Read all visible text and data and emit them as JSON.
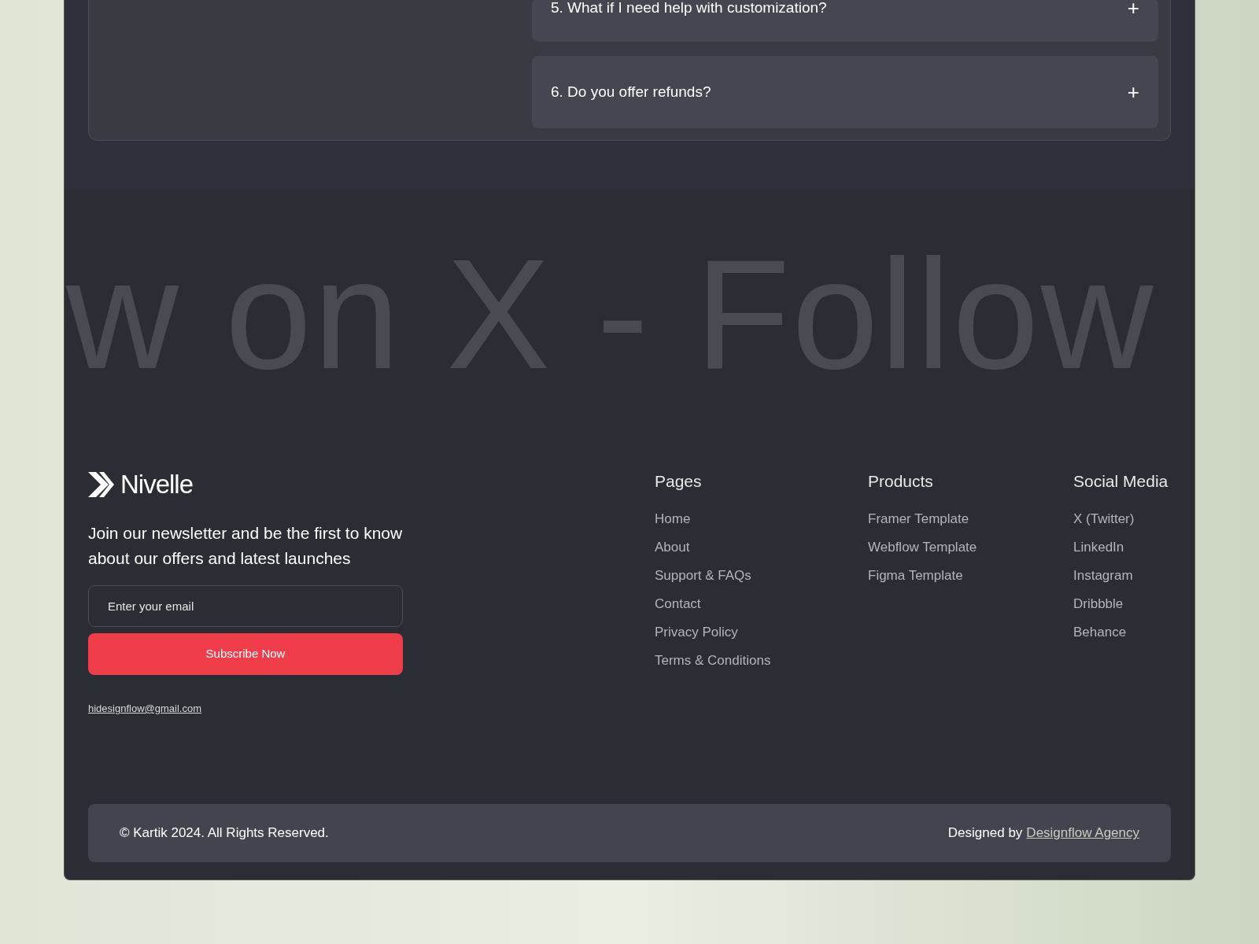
{
  "faq": {
    "items": [
      {
        "question": "5. What if I need help with customization?",
        "expanded": false,
        "toggle": "+"
      },
      {
        "question": "6. Do you offer refunds?",
        "expanded": false,
        "toggle": "+"
      }
    ]
  },
  "marquee": {
    "text": "w on X - Follow"
  },
  "footer": {
    "brand": "Nivelle",
    "newsletter_text": "Join our newsletter and be the first to know about our offers and latest launches",
    "email_field": {
      "placeholder": "Enter your email"
    },
    "subscribe_button": "Subscribe Now",
    "contact_email": "hidesignflow@gmail.com",
    "columns": [
      {
        "heading": "Pages",
        "links": [
          "Home",
          "About",
          "Support & FAQs",
          "Contact",
          "Privacy Policy",
          "Terms & Conditions"
        ]
      },
      {
        "heading": "Products",
        "links": [
          "Framer Template",
          "Webflow Template",
          "Figma Template"
        ]
      },
      {
        "heading": "Social Media",
        "links": [
          "X (Twitter)",
          "LinkedIn",
          "Instagram",
          "Dribbble",
          "Behance"
        ]
      }
    ]
  },
  "bottom_bar": {
    "copyright": "© Kartik 2024. All Rights Reserved.",
    "credit_prefix": "Designed by",
    "credit_link": "Designflow Agency"
  }
}
